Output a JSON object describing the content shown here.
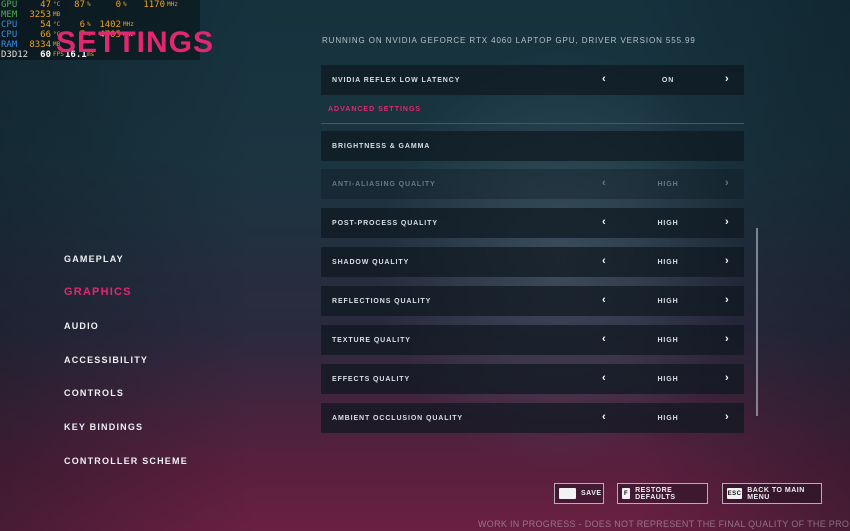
{
  "perf_overlay": {
    "rows": [
      {
        "label": "GPU",
        "v1": "47",
        "u1": "°C",
        "v2": "87",
        "u2": "%",
        "v3": "0",
        "u3": "%",
        "v4": "1170",
        "u4": "MHz"
      },
      {
        "label": "MEM",
        "v1": "3253",
        "u1": "MB",
        "v2": "",
        "u2": "",
        "v3": "",
        "u3": "",
        "v4": "",
        "u4": ""
      },
      {
        "label": "CPU",
        "v1": "54",
        "u1": "°C",
        "v2": "6",
        "u2": "%",
        "v3": "1402",
        "u3": "MHz",
        "v4": "",
        "u4": ""
      },
      {
        "label": "CPU",
        "v1": "66",
        "u1": "°C",
        "v2": "7",
        "u2": "%",
        "v3": "4705",
        "u3": "MHz",
        "v4": "",
        "u4": ""
      },
      {
        "label": "RAM",
        "v1": "8334",
        "u1": "MB",
        "v2": "",
        "u2": "",
        "v3": "",
        "u3": "",
        "v4": "",
        "u4": ""
      },
      {
        "label": "D3D12",
        "v1": "60",
        "u1": "FPS",
        "v2": "16.1",
        "u2": "ms",
        "v3": "",
        "u3": "",
        "v4": "",
        "u4": ""
      }
    ]
  },
  "page": {
    "title": "SETTINGS",
    "gpu_info": "RUNNING ON NVIDIA GEFORCE RTX 4060 LAPTOP GPU, DRIVER VERSION 555.99"
  },
  "nav": {
    "items": [
      "GAMEPLAY",
      "GRAPHICS",
      "AUDIO",
      "ACCESSIBILITY",
      "CONTROLS",
      "KEY BINDINGS",
      "CONTROLLER SCHEME"
    ],
    "active": "GRAPHICS"
  },
  "settings": {
    "reflex": {
      "label": "NVIDIA REFLEX LOW LATENCY",
      "value": "ON"
    },
    "advanced_header": "ADVANCED SETTINGS",
    "brightness": {
      "label": "BRIGHTNESS & GAMMA"
    },
    "anti_aliasing": {
      "label": "ANTI-ALIASING QUALITY",
      "value": "HIGH",
      "disabled": true
    },
    "post_process": {
      "label": "POST-PROCESS QUALITY",
      "value": "HIGH"
    },
    "shadow": {
      "label": "SHADOW QUALITY",
      "value": "HIGH"
    },
    "reflections": {
      "label": "REFLECTIONS QUALITY",
      "value": "HIGH"
    },
    "texture": {
      "label": "TEXTURE QUALITY",
      "value": "HIGH"
    },
    "effects": {
      "label": "EFFECTS  QUALITY",
      "value": "HIGH"
    },
    "ambient_occlusion": {
      "label": "AMBIENT OCCLUSION QUALITY",
      "value": "HIGH"
    },
    "arrow_left": "‹",
    "arrow_right": "›"
  },
  "footer": {
    "save": {
      "key": "",
      "label": "SAVE"
    },
    "restore": {
      "key": "F",
      "label": "RESTORE DEFAULTS"
    },
    "back": {
      "key": "ESC",
      "label": "BACK TO MAIN MENU"
    },
    "wip": "WORK IN PROGRESS - DOES NOT REPRESENT THE FINAL QUALITY OF THE PRODUCT"
  },
  "colors": {
    "accent": "#e0286e"
  }
}
